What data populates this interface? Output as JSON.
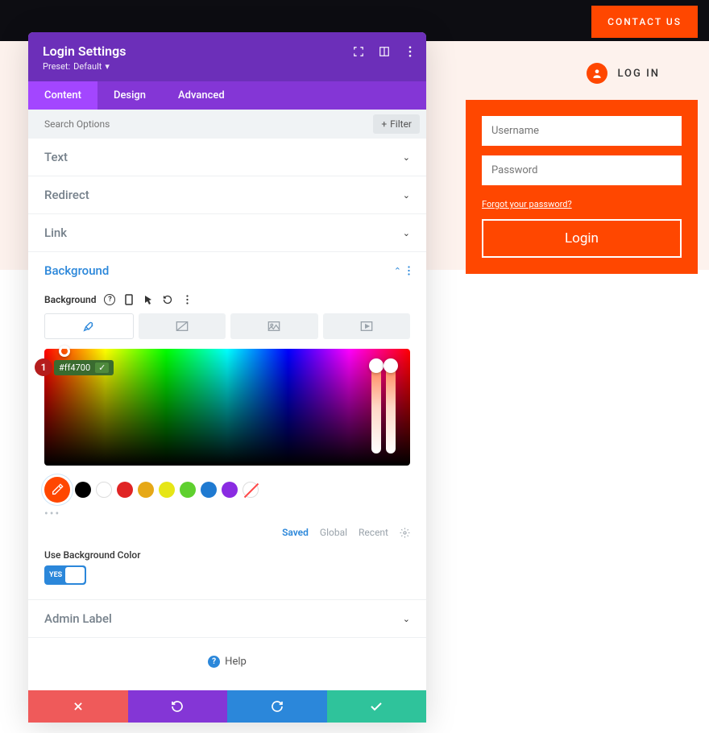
{
  "topbar": {
    "contact": "CONTACT US"
  },
  "panel": {
    "title": "Login Settings",
    "preset_label": "Preset:",
    "preset_value": "Default",
    "tabs": {
      "content": "Content",
      "design": "Design",
      "advanced": "Advanced"
    },
    "search_placeholder": "Search Options",
    "filter": "Filter"
  },
  "sections": {
    "text": "Text",
    "redirect": "Redirect",
    "link": "Link",
    "background": "Background",
    "admin_label": "Admin Label"
  },
  "bg": {
    "label": "Background",
    "hex": "#ff4700",
    "saved": "Saved",
    "global": "Global",
    "recent": "Recent",
    "use_label": "Use Background Color",
    "toggle": "YES",
    "marker": "1"
  },
  "swatches": [
    "#000000",
    "#ffffff",
    "#e02424",
    "#e6a817",
    "#e6e617",
    "#5fd02f",
    "#1f7ad1",
    "#8a2be2"
  ],
  "help": "Help",
  "login": {
    "head": "LOG IN",
    "username_ph": "Username",
    "password_ph": "Password",
    "forgot": "Forgot your password?",
    "button": "Login"
  }
}
